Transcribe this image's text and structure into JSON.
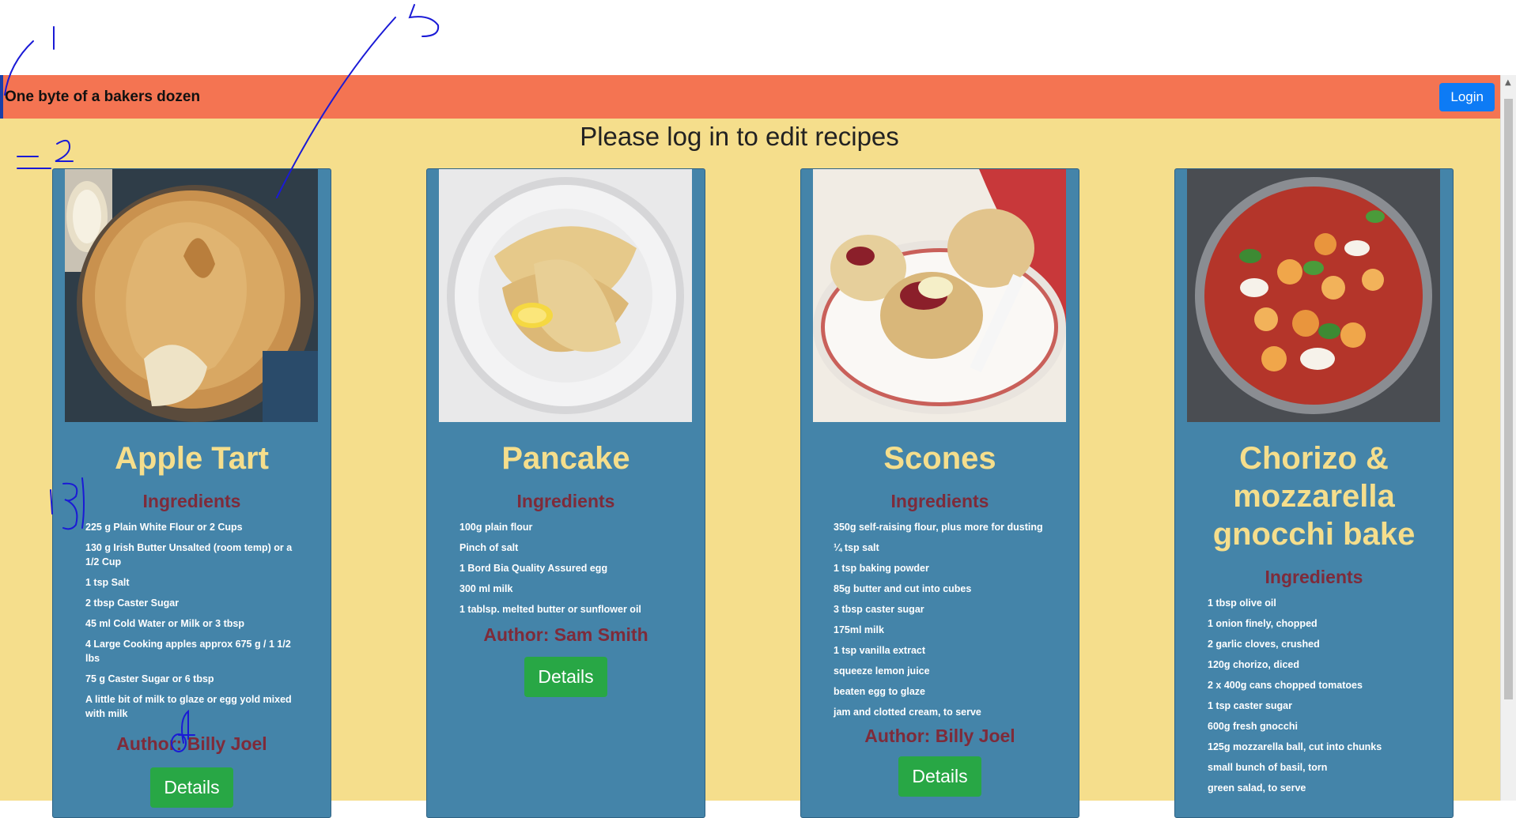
{
  "navbar": {
    "brand": "One byte of a bakers dozen",
    "login_label": "Login"
  },
  "notice": "Please log in to edit recipes",
  "recipes": [
    {
      "title": "Apple Tart",
      "ingredients_heading": "Ingredients",
      "ingredients": [
        "225 g Plain White Flour or 2 Cups",
        "130 g Irish Butter Unsalted (room temp) or a 1/2 Cup",
        "1 tsp Salt",
        "2 tbsp Caster Sugar",
        "45 ml Cold Water or Milk or 3 tbsp",
        "4 Large Cooking apples approx 675 g / 1 1/2 lbs",
        "75 g Caster Sugar or 6 tbsp",
        "A little bit of milk to glaze or egg yold mixed with milk"
      ],
      "author": "Author: Billy Joel",
      "details_label": "Details"
    },
    {
      "title": "Pancake",
      "ingredients_heading": "Ingredients",
      "ingredients": [
        "100g plain flour",
        "Pinch of salt",
        "1 Bord Bia Quality Assured egg",
        "300 ml milk",
        "1 tablsp. melted butter or sunflower oil"
      ],
      "author": "Author: Sam Smith",
      "details_label": "Details"
    },
    {
      "title": "Scones",
      "ingredients_heading": "Ingredients",
      "ingredients": [
        "350g self-raising flour, plus more for dusting",
        "¼ tsp salt",
        "1 tsp baking powder",
        "85g butter and cut into cubes",
        "3 tbsp caster sugar",
        "175ml milk",
        "1 tsp vanilla extract",
        "squeeze lemon juice",
        "beaten egg to glaze",
        "jam and clotted cream, to serve"
      ],
      "author": "Author: Billy Joel",
      "details_label": "Details"
    },
    {
      "title": "Chorizo & mozzarella gnocchi bake",
      "ingredients_heading": "Ingredients",
      "ingredients": [
        "1 tbsp olive oil",
        "1 onion finely, chopped",
        "2 garlic cloves, crushed",
        "120g chorizo, diced",
        "2 x 400g cans chopped tomatoes",
        "1 tsp caster sugar",
        "600g fresh gnocchi",
        "125g mozzarella ball, cut into chunks",
        "small bunch of basil, torn",
        "green salad, to serve"
      ],
      "author": "",
      "details_label": ""
    }
  ],
  "annotations": [
    "1",
    "2",
    "3",
    "4",
    "5"
  ],
  "colors": {
    "navbar": "#f47452",
    "background": "#f5de8c",
    "card": "#4484a9",
    "title": "#f5de8c",
    "heading": "#7e2b3a",
    "details": "#28a745",
    "login": "#0d7bf5"
  }
}
